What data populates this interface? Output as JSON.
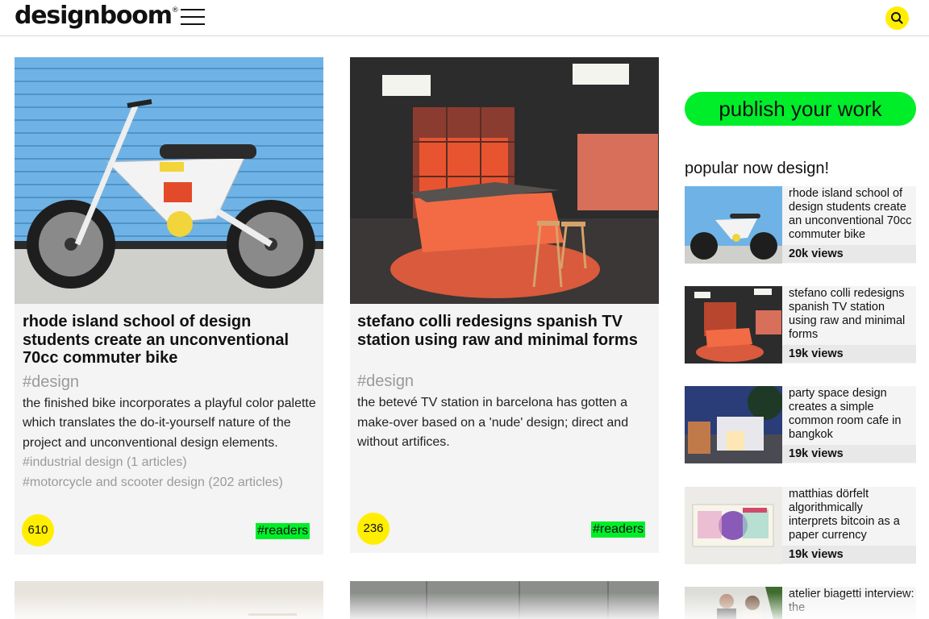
{
  "header": {
    "logo": "designboom",
    "logo_mark": "®"
  },
  "articles": [
    {
      "title": "rhode island school of design students create an unconventional 70cc commuter bike",
      "category": "#design",
      "description": "the finished bike incorporates a playful color palette which translates the do-it-yourself nature of the project and unconventional design elements.",
      "tags": [
        "#industrial design (1 articles)",
        "#motorcycle and scooter design (202 articles)"
      ],
      "count": "610",
      "badge": "#readers"
    },
    {
      "title": "stefano colli redesigns spanish TV station using raw and minimal forms",
      "category": "#design",
      "description": "the betevé TV station in barcelona has gotten a make-over based on a 'nude' design; direct and without artifices.",
      "tags": [],
      "count": "236",
      "badge": "#readers"
    }
  ],
  "sidebar": {
    "publish_label": "publish your work",
    "popular_title": "popular now design!",
    "items": [
      {
        "title": "rhode island school of design students create an unconventional 70cc commuter bike",
        "views": "20k views"
      },
      {
        "title": "stefano colli redesigns spanish TV station using raw and minimal forms",
        "views": "19k views"
      },
      {
        "title": "party space design creates a simple common room cafe in bangkok",
        "views": "19k views"
      },
      {
        "title": "matthias dörfelt algorithmically interprets bitcoin as a paper currency",
        "views": "19k views"
      },
      {
        "title": "atelier biagetti interview: the",
        "views": ""
      }
    ]
  },
  "colors": {
    "accent_yellow": "#ffee00",
    "accent_green": "#00ee2a",
    "card_bg": "#f4f4f4"
  },
  "icons": [
    "menu-icon",
    "search-icon"
  ]
}
